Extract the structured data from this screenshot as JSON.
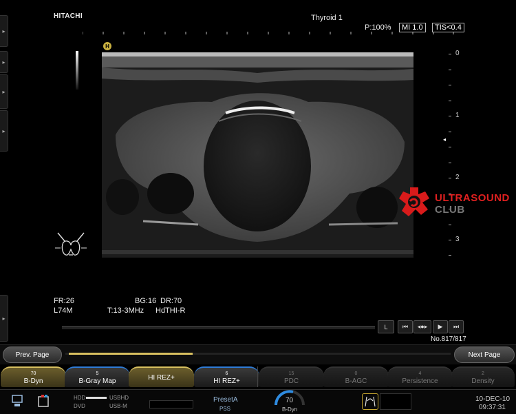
{
  "header": {
    "brand": "HITACHI",
    "preset": "Thyroid 1",
    "power": "P:100%",
    "mi": "MI 1.0",
    "tis": "TIS<0.4"
  },
  "image_marker": "H",
  "depth_scale": {
    "labels": [
      "0",
      "1",
      "2",
      "3"
    ]
  },
  "watermark": {
    "line1": "ULTRASOUND",
    "line2": "CLUB"
  },
  "params": {
    "fr": "FR:26",
    "probe": "L74M",
    "bg": "BG:16",
    "dr": "DR:70",
    "freq": "T:13-3MHz",
    "mode": "HdTHI-R"
  },
  "cine": {
    "loop_label": "L",
    "buttons": [
      "⏮",
      "◂●▸",
      "▶",
      "⏭"
    ],
    "frame_counter": "No.817/817"
  },
  "pager": {
    "prev": "Prev. Page",
    "next": "Next Page"
  },
  "softkeys": [
    {
      "value": "70",
      "label": "B-Dyn",
      "state": "sel"
    },
    {
      "value": "5",
      "label": "B-Gray Map",
      "state": "on"
    },
    {
      "value": "",
      "label": "HI REZ+",
      "state": "sel"
    },
    {
      "value": "6",
      "label": "HI REZ+",
      "state": "on"
    },
    {
      "value": "15",
      "label": "PDC",
      "state": "off"
    },
    {
      "value": "0",
      "label": "B-AGC",
      "state": "off"
    },
    {
      "value": "4",
      "label": "Persistence",
      "state": "off"
    },
    {
      "value": "2",
      "label": "Density",
      "state": "off"
    }
  ],
  "status": {
    "hdd": "HDD",
    "usbhd": "USBHD",
    "dvd": "DVD",
    "usbm": "USB-M",
    "preset_name": "PresetA",
    "pss": "PSS",
    "dial_value": "70",
    "dial_label": "B-Dyn",
    "date": "10-DEC-10",
    "time": "09:37:31"
  }
}
